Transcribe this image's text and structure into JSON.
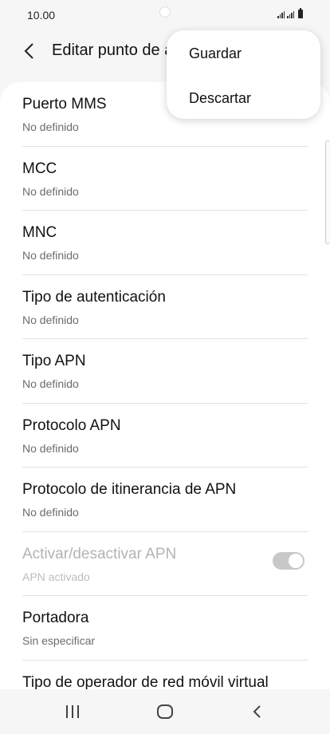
{
  "status_bar": {
    "time": "10.00"
  },
  "app_bar": {
    "title": "Editar punto de acceso"
  },
  "menu": {
    "items": [
      "Guardar",
      "Descartar"
    ]
  },
  "list": {
    "items": [
      {
        "title": "Puerto MMS",
        "subtitle": "No definido"
      },
      {
        "title": "MCC",
        "subtitle": "No definido"
      },
      {
        "title": "MNC",
        "subtitle": "No definido"
      },
      {
        "title": "Tipo de autenticación",
        "subtitle": "No definido"
      },
      {
        "title": "Tipo APN",
        "subtitle": "No definido"
      },
      {
        "title": "Protocolo APN",
        "subtitle": "No definido"
      },
      {
        "title": "Protocolo de itinerancia de APN",
        "subtitle": "No definido"
      },
      {
        "title": "Activar/desactivar APN",
        "subtitle": "APN activado",
        "toggle_on": true,
        "disabled": true
      },
      {
        "title": "Portadora",
        "subtitle": "Sin especificar"
      },
      {
        "title": "Tipo de operador de red móvil virtual",
        "subtitle": ""
      }
    ]
  },
  "icons": {
    "back": "chevron-left-icon",
    "nav_recents": "recents-icon",
    "nav_home": "home-icon",
    "nav_back": "back-icon"
  }
}
